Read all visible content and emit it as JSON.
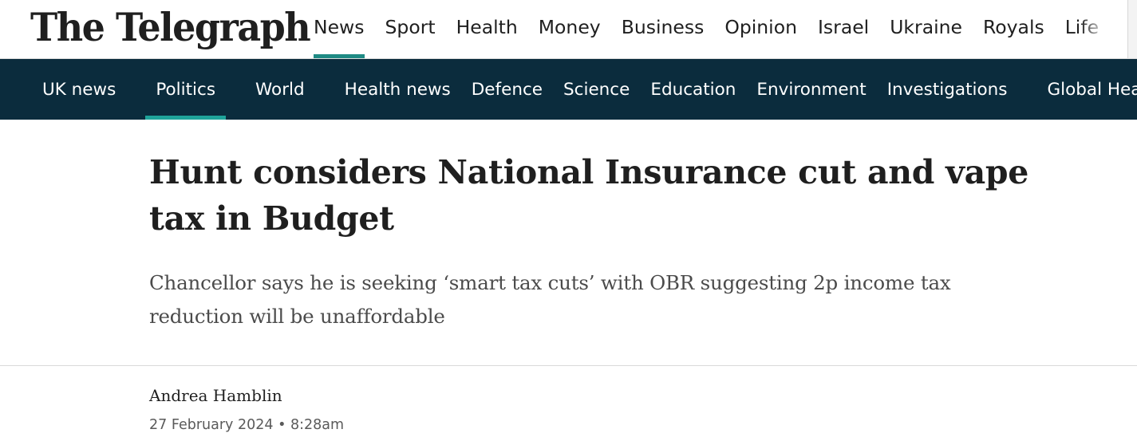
{
  "header": {
    "logo": "The Telegraph",
    "primary_nav": [
      {
        "label": "News",
        "active": true
      },
      {
        "label": "Sport",
        "active": false
      },
      {
        "label": "Health",
        "active": false
      },
      {
        "label": "Money",
        "active": false
      },
      {
        "label": "Business",
        "active": false
      },
      {
        "label": "Opinion",
        "active": false
      },
      {
        "label": "Israel",
        "active": false
      },
      {
        "label": "Ukraine",
        "active": false
      },
      {
        "label": "Royals",
        "active": false
      },
      {
        "label": "Life",
        "active": false
      }
    ]
  },
  "sub_nav": [
    {
      "label": "UK news",
      "active": false
    },
    {
      "label": "Politics",
      "active": true
    },
    {
      "label": "World",
      "active": false
    },
    {
      "label": "Health news",
      "active": false
    },
    {
      "label": "Defence",
      "active": false
    },
    {
      "label": "Science",
      "active": false
    },
    {
      "label": "Education",
      "active": false
    },
    {
      "label": "Environment",
      "active": false
    },
    {
      "label": "Investigations",
      "active": false
    },
    {
      "label": "Global Health",
      "active": false
    }
  ],
  "article": {
    "headline": "Hunt considers National Insurance cut and vape tax in Budget",
    "standfirst": "Chancellor says he is seeking ‘smart tax cuts’ with OBR suggesting 2p income tax reduction will be unaffordable",
    "author": "Andrea Hamblin",
    "date": "27 February 2024",
    "separator": "•",
    "time": "8:28am"
  },
  "colors": {
    "accent": "#1f8a84",
    "sub_nav_bg": "#0b2c3d",
    "text": "#1f1f1f"
  }
}
